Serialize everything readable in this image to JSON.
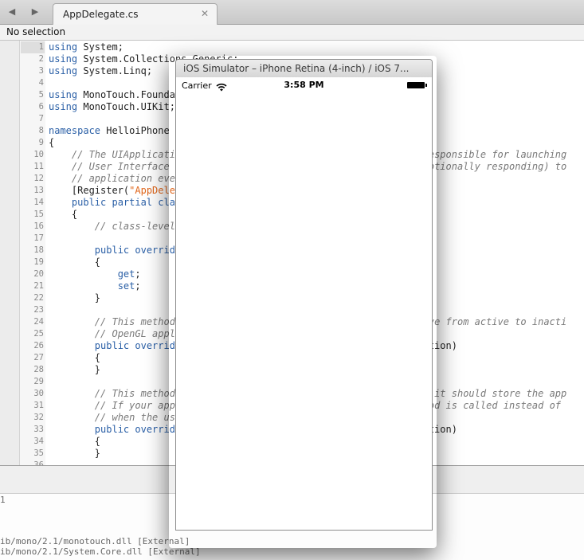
{
  "ide": {
    "tab": {
      "label": "AppDelegate.cs",
      "close": "✕"
    },
    "nav": {
      "back": "◀",
      "forward": "▶"
    },
    "selection": "No selection",
    "code_lines": [
      {
        "n": "1",
        "t": "<span class=\"kw\">using</span> System;"
      },
      {
        "n": "2",
        "t": "<span class=\"kw\">using</span> System.Collections.Generic;"
      },
      {
        "n": "3",
        "t": "<span class=\"kw\">using</span> System.Linq;"
      },
      {
        "n": "4",
        "t": ""
      },
      {
        "n": "5",
        "t": "<span class=\"kw\">using</span> MonoTouch.Founda"
      },
      {
        "n": "6",
        "t": "<span class=\"kw\">using</span> MonoTouch.UIKit;"
      },
      {
        "n": "7",
        "t": ""
      },
      {
        "n": "8",
        "t": "<span class=\"kw\">namespace</span> HelloiPhone"
      },
      {
        "n": "9",
        "t": "{"
      },
      {
        "n": "10",
        "t": "    <span class=\"cm\">// The UIApplicati</span>                                         <span class=\"cm\">s responsible for launching</span>"
      },
      {
        "n": "11",
        "t": "    <span class=\"cm\">// User Interface</span>                                          <span class=\"cm\">d optionally responding) to</span>"
      },
      {
        "n": "12",
        "t": "    <span class=\"cm\">// application eve</span>"
      },
      {
        "n": "13",
        "t": "    [Register(<span class=\"st\">\"AppDele</span>"
      },
      {
        "n": "14",
        "t": "    <span class=\"kw\">public partial</span> <span class=\"kw\">cla</span>"
      },
      {
        "n": "15",
        "t": "    {"
      },
      {
        "n": "16",
        "t": "        <span class=\"cm\">// class-level</span>"
      },
      {
        "n": "17",
        "t": ""
      },
      {
        "n": "18",
        "t": "        <span class=\"kw\">public override</span>"
      },
      {
        "n": "19",
        "t": "        {"
      },
      {
        "n": "20",
        "t": "            <span class=\"kw\">get</span>;"
      },
      {
        "n": "21",
        "t": "            <span class=\"kw\">set</span>;"
      },
      {
        "n": "22",
        "t": "        }"
      },
      {
        "n": "23",
        "t": ""
      },
      {
        "n": "24",
        "t": "        <span class=\"cm\">// This method</span>                                          <span class=\"cm\">move from active to inacti</span>"
      },
      {
        "n": "25",
        "t": "        <span class=\"cm\">// OpenGL appl</span>"
      },
      {
        "n": "26",
        "t": "        <span class=\"kw\">public override</span>                                        ication)"
      },
      {
        "n": "27",
        "t": "        {"
      },
      {
        "n": "28",
        "t": "        }"
      },
      {
        "n": "29",
        "t": ""
      },
      {
        "n": "30",
        "t": "        <span class=\"cm\">// This method</span>                                         <span class=\"cm\">and it should store the app</span>"
      },
      {
        "n": "31",
        "t": "        <span class=\"cm\">// If your app</span>                                         <span class=\"cm\">ethod is called instead of</span>"
      },
      {
        "n": "32",
        "t": "        <span class=\"cm\">// when the us</span>"
      },
      {
        "n": "33",
        "t": "        <span class=\"kw\">public override</span>                                        ication)"
      },
      {
        "n": "34",
        "t": "        {"
      },
      {
        "n": "35",
        "t": "        }"
      },
      {
        "n": "36",
        "t": ""
      }
    ],
    "output": {
      "line_number": "1",
      "lines": [
        "ib/mono/2.1/monotouch.dll [External]",
        "ib/mono/2.1/System.Core.dll [External]"
      ]
    }
  },
  "simulator": {
    "title": "iOS Simulator – iPhone Retina (4-inch) / iOS 7...",
    "status_bar": {
      "carrier": "Carrier",
      "time": "3:58 PM"
    }
  }
}
